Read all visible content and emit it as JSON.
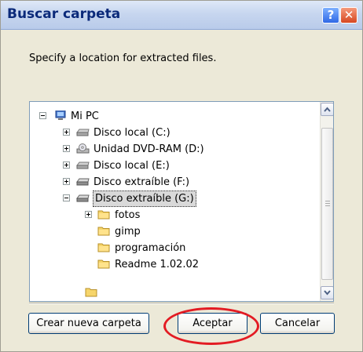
{
  "window": {
    "title": "Buscar carpeta",
    "help_glyph": "?",
    "close_glyph": "✕"
  },
  "description": "Specify a location for extracted files.",
  "tree": {
    "items": [
      {
        "label": "Mi PC",
        "icon": "computer-icon",
        "expander": "minus"
      },
      {
        "label": "Disco local (C:)",
        "icon": "hard-drive-icon",
        "expander": "plus"
      },
      {
        "label": "Unidad DVD-RAM (D:)",
        "icon": "dvd-drive-icon",
        "expander": "plus"
      },
      {
        "label": "Disco local (E:)",
        "icon": "hard-drive-icon",
        "expander": "plus"
      },
      {
        "label": "Disco extraíble (F:)",
        "icon": "removable-drive-icon",
        "expander": "plus"
      },
      {
        "label": "Disco extraíble (G:)",
        "icon": "removable-drive-icon",
        "expander": "minus",
        "selected": true
      },
      {
        "label": "fotos",
        "icon": "folder-icon",
        "expander": "plus"
      },
      {
        "label": "gimp",
        "icon": "folder-icon",
        "expander": "none"
      },
      {
        "label": "programación",
        "icon": "folder-icon",
        "expander": "none"
      },
      {
        "label": "Readme 1.02.02",
        "icon": "folder-icon",
        "expander": "none"
      }
    ]
  },
  "buttons": {
    "new_folder": "Crear nueva carpeta",
    "accept": "Aceptar",
    "cancel": "Cancelar"
  },
  "colors": {
    "title_text": "#0b2a7a",
    "highlight_oval": "#e31b23",
    "dialog_background": "#ece9d8"
  }
}
